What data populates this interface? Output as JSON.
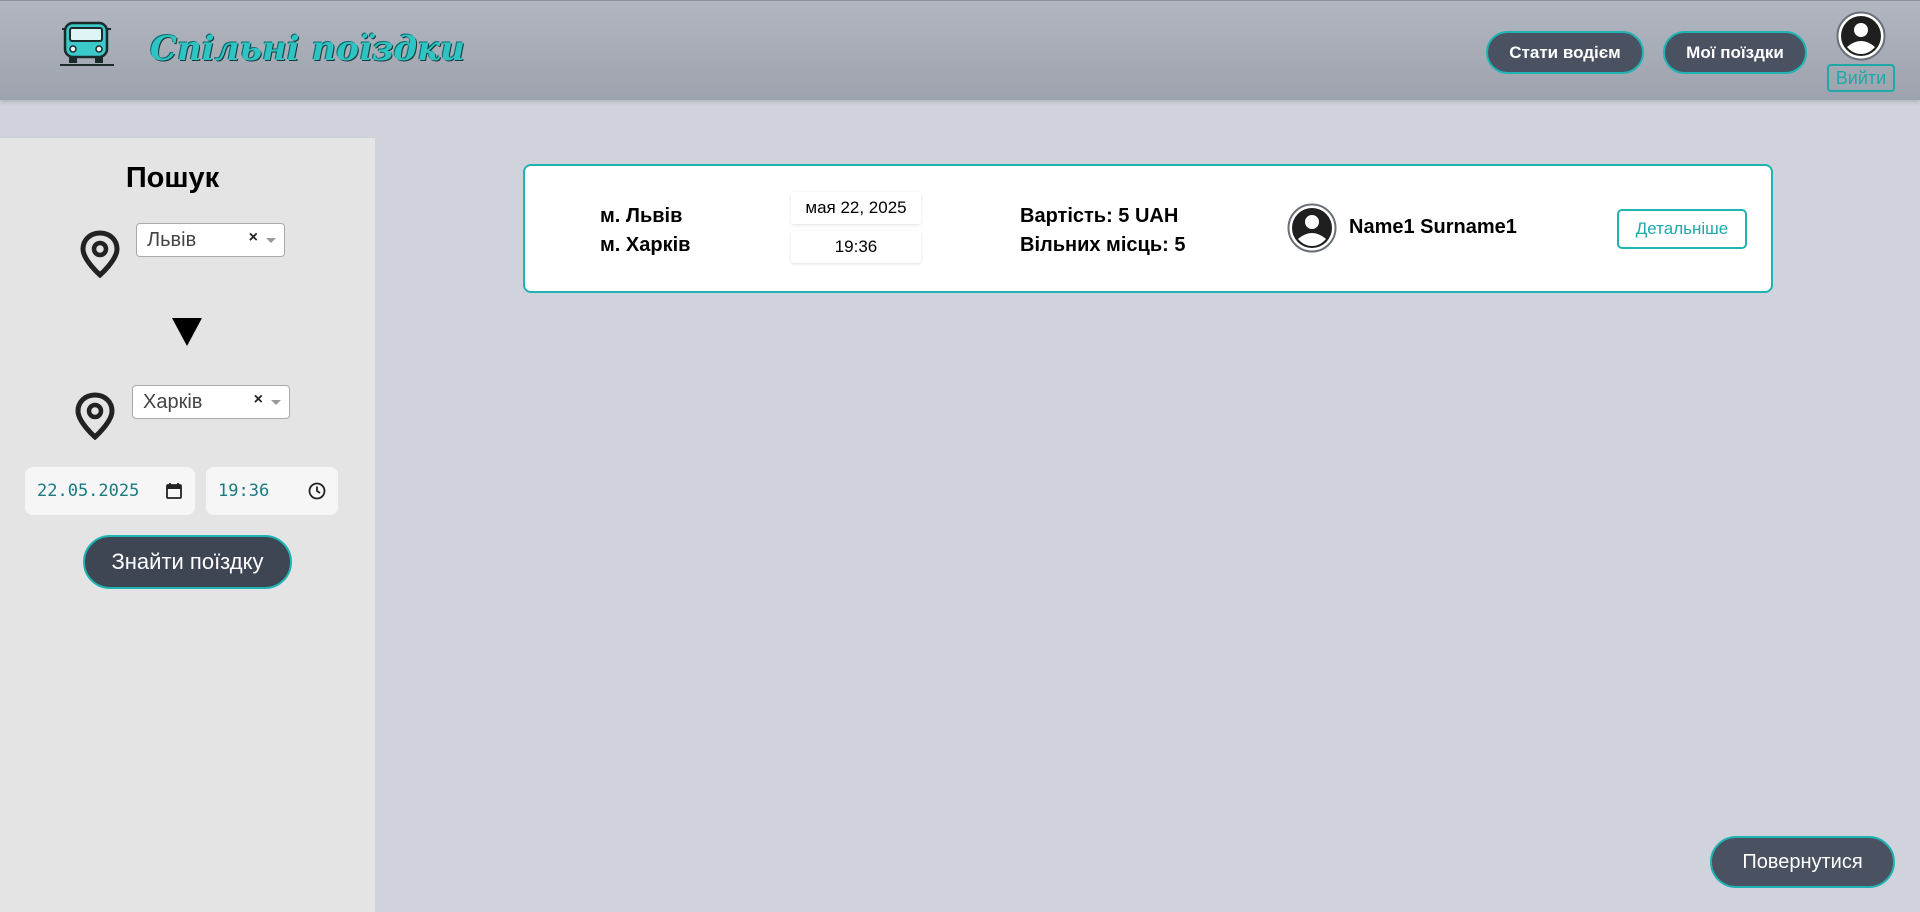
{
  "header": {
    "brand": "Спільні поїздки",
    "become_driver": "Стати водієм",
    "my_trips": "Мої поїздки",
    "logout": "Вийти"
  },
  "search": {
    "title": "Пошук",
    "from": "Львів",
    "to": "Харків",
    "clear_glyph": "×",
    "date": "22.05.2025",
    "time": "19:36",
    "submit": "Знайти поїздку"
  },
  "results": [
    {
      "from": "м. Львів",
      "to": "м. Харків",
      "date": "мая 22, 2025",
      "time": "19:36",
      "price": "Вартість: 5 UAH",
      "seats": "Вільних місць: 5",
      "driver": "Name1 Surname1",
      "details": "Детальніше"
    }
  ],
  "back": "Повернутися",
  "colors": {
    "accent": "#1fb3b3",
    "button_dark": "#4a5261",
    "background": "#d0d3db",
    "sidebar": "#e4e4e4"
  },
  "icons": {
    "logo": "bus-icon",
    "profile": "user-avatar-icon",
    "location": "map-pin-icon",
    "arrow": "down-triangle-icon",
    "calendar": "calendar-icon",
    "clock": "clock-icon"
  }
}
